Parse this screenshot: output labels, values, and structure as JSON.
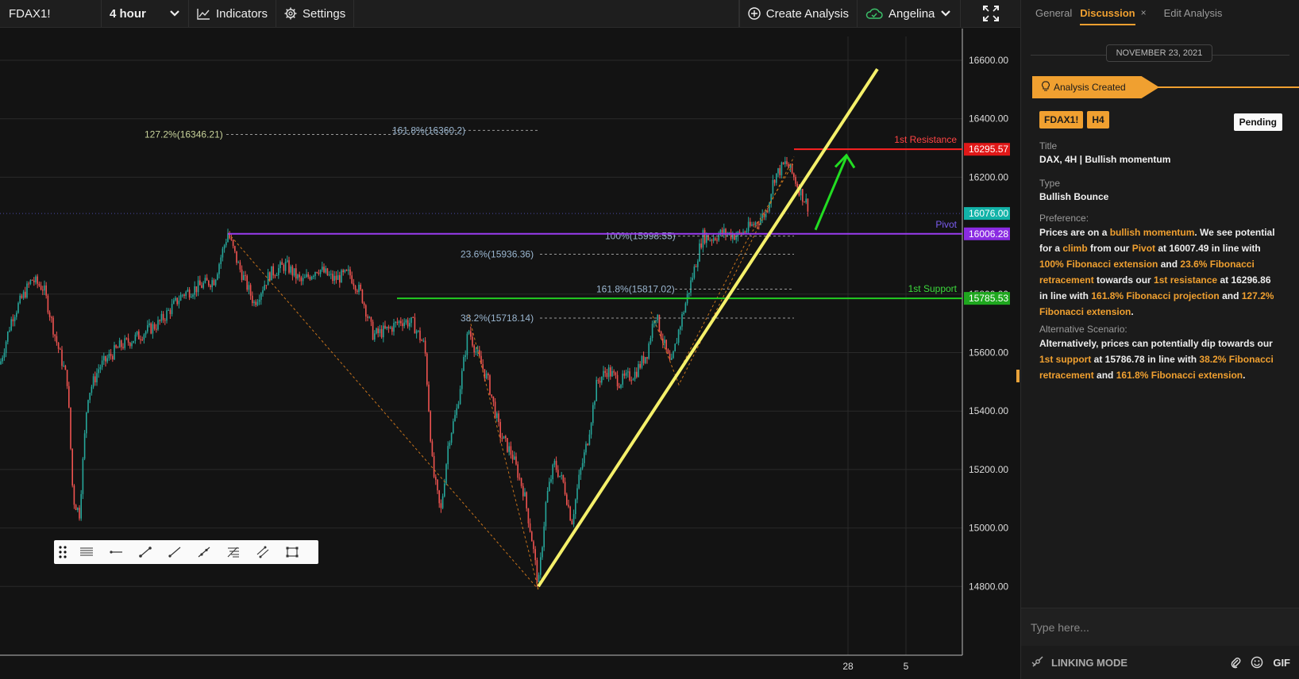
{
  "toolbar": {
    "symbol": "FDAX1!",
    "interval": "4 hour",
    "indicators_label": "Indicators",
    "settings_label": "Settings",
    "create_analysis_label": "Create Analysis",
    "user_name": "Angelina"
  },
  "chart": {
    "price_ticks": [
      "16600.00",
      "16400.00",
      "16200.00",
      "15800.00",
      "15600.00",
      "15400.00",
      "15200.00",
      "15000.00",
      "14800.00"
    ],
    "time_ticks": [
      "28",
      "5"
    ],
    "levels": {
      "resistance": {
        "label": "1st Resistance",
        "price": "16295.57",
        "color": "#ff2222"
      },
      "pivot": {
        "label": "Pivot",
        "price": "16006.28",
        "color": "#9a3cf0"
      },
      "support": {
        "label": "1st Support",
        "price": "15785.53",
        "color": "#22cc22"
      },
      "current": {
        "price": "16076.00",
        "color": "#12b3a8"
      }
    },
    "fib_labels": {
      "ext_1272": "127.2%(16346.21)",
      "proj_1618_top": "161.8%(16360.2)",
      "ext_100": "100%(15998.55)",
      "ret_236": "23.6%(15936.36)",
      "proj_1618": "161.8%(15817.02)",
      "ret_382": "38.2%(15718.14)"
    }
  },
  "drawing_tools": [
    "drag-handle",
    "horizontal-lines-icon",
    "horizontal-ray-icon",
    "trend-line-icon",
    "line-icon",
    "ray-icon",
    "fib-retracement-icon",
    "parallel-channel-icon",
    "rectangle-icon"
  ],
  "panel": {
    "tabs": [
      {
        "label": "General"
      },
      {
        "label": "Discussion",
        "active": true,
        "close": "×"
      },
      {
        "label": "Edit Analysis"
      }
    ],
    "date": "NOVEMBER 23, 2021",
    "event_label": "Analysis Created",
    "badges": [
      "FDAX1!",
      "H4"
    ],
    "status": "Pending",
    "title_label": "Title",
    "title_value": "DAX, 4H | Bullish momentum",
    "type_label": "Type",
    "type_value": "Bullish Bounce",
    "preference_label": "Preference:",
    "preference_parts": [
      {
        "t": "Prices are on a "
      },
      {
        "t": "bullish momentum",
        "hl": true
      },
      {
        "t": ". We see potential for a "
      },
      {
        "t": "climb",
        "hl": true
      },
      {
        "t": " from our "
      },
      {
        "t": "Pivot",
        "hl": true
      },
      {
        "t": " at 16007.49 in line with "
      },
      {
        "t": "100% Fibonacci extension",
        "hl": true
      },
      {
        "t": " and "
      },
      {
        "t": "23.6% Fibonacci retracement",
        "hl": true
      },
      {
        "t": " towards our "
      },
      {
        "t": "1st resistance",
        "hl": true
      },
      {
        "t": " at 16296.86 in line with "
      },
      {
        "t": "161.8% Fibonacci projection",
        "hl": true
      },
      {
        "t": " and "
      },
      {
        "t": "127.2% Fibonacci extension",
        "hl": true
      },
      {
        "t": "."
      }
    ],
    "alternative_label": "Alternative Scenario:",
    "alternative_parts": [
      {
        "t": "Alternatively, prices can potentially dip towards our "
      },
      {
        "t": "1st support",
        "hl": true
      },
      {
        "t": " at 15786.78 in line with "
      },
      {
        "t": "38.2% Fibonacci retracement",
        "hl": true
      },
      {
        "t": " and "
      },
      {
        "t": "161.8% Fibonacci extension",
        "hl": true
      },
      {
        "t": "."
      }
    ],
    "compose_placeholder": "Type here...",
    "linking_mode_label": "LINKING MODE",
    "gif_label": "GIF"
  },
  "colors": {
    "accent": "#f0a030",
    "up": "#26a69a",
    "down": "#ef5350",
    "trend": "#f5f06a"
  }
}
